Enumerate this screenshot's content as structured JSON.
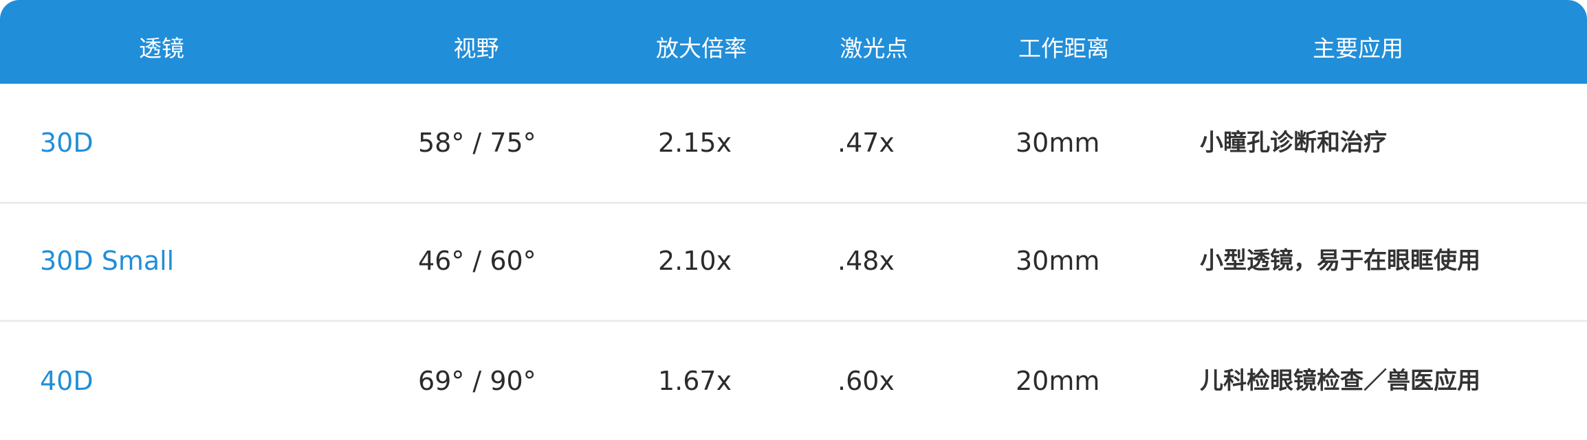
{
  "table": {
    "headers": [
      "透镜",
      "视野",
      "放大倍率",
      "激光点",
      "工作距离",
      "主要应用"
    ],
    "rows": [
      {
        "lens": "30D",
        "field_of_view": "58° / 75°",
        "magnification": "2.15x",
        "laser_spot": ".47x",
        "working_distance": "30mm",
        "application": "小瞳孔诊断和治疗"
      },
      {
        "lens": "30D Small",
        "field_of_view": "46° / 60°",
        "magnification": "2.10x",
        "laser_spot": ".48x",
        "working_distance": "30mm",
        "application": "小型透镜，易于在眼眶使用"
      },
      {
        "lens": "40D",
        "field_of_view": "69° / 90°",
        "magnification": "1.67x",
        "laser_spot": ".60x",
        "working_distance": "20mm",
        "application": "儿科检眼镜检查／兽医应用"
      }
    ]
  },
  "colors": {
    "header_background": "#218ed9",
    "header_text": "#ffffff",
    "lens_text": "#218ed9",
    "body_text": "#2b2b2b",
    "row_divider": "#ececec"
  }
}
